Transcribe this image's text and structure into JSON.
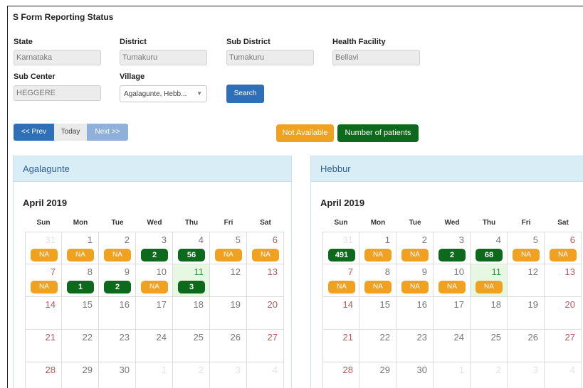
{
  "page": {
    "title": "S Form Reporting Status"
  },
  "filters": {
    "state": {
      "label": "State",
      "value": "Karnataka"
    },
    "district": {
      "label": "District",
      "value": "Tumakuru"
    },
    "sub_district": {
      "label": "Sub District",
      "value": "Tumakuru"
    },
    "health_facility": {
      "label": "Health Facility",
      "value": "Bellavi"
    },
    "sub_center": {
      "label": "Sub Center",
      "value": "HEGGERE"
    },
    "village": {
      "label": "Village",
      "value": "Agalagunte, Hebb..."
    },
    "search_label": "Search"
  },
  "nav": {
    "prev": "<< Prev",
    "today": "Today",
    "next": "Next >>"
  },
  "legend": {
    "not_available": {
      "label": "Not Available",
      "color": "#f0a11f"
    },
    "patients": {
      "label": "Number of patients",
      "color": "#0d6a1d"
    }
  },
  "weekdays": [
    "Sun",
    "Mon",
    "Tue",
    "Wed",
    "Thu",
    "Fri",
    "Sat"
  ],
  "calendars": [
    {
      "village": "Agalagunte",
      "month": "April 2019",
      "weeks": [
        [
          {
            "day": "31",
            "other": true,
            "status": "NA"
          },
          {
            "day": "1",
            "status": "NA"
          },
          {
            "day": "2",
            "status": "NA"
          },
          {
            "day": "3",
            "status": "2"
          },
          {
            "day": "4",
            "status": "56"
          },
          {
            "day": "5",
            "status": "NA"
          },
          {
            "day": "6",
            "status": "NA"
          }
        ],
        [
          {
            "day": "7",
            "status": "NA"
          },
          {
            "day": "8",
            "status": "1"
          },
          {
            "day": "9",
            "status": "2"
          },
          {
            "day": "10",
            "status": "NA"
          },
          {
            "day": "11",
            "today": true,
            "status": "3"
          },
          {
            "day": "12"
          },
          {
            "day": "13"
          }
        ],
        [
          {
            "day": "14"
          },
          {
            "day": "15"
          },
          {
            "day": "16"
          },
          {
            "day": "17"
          },
          {
            "day": "18"
          },
          {
            "day": "19"
          },
          {
            "day": "20"
          }
        ],
        [
          {
            "day": "21"
          },
          {
            "day": "22"
          },
          {
            "day": "23"
          },
          {
            "day": "24"
          },
          {
            "day": "25"
          },
          {
            "day": "26"
          },
          {
            "day": "27"
          }
        ],
        [
          {
            "day": "28"
          },
          {
            "day": "29"
          },
          {
            "day": "30"
          },
          {
            "day": "1",
            "other": true
          },
          {
            "day": "2",
            "other": true
          },
          {
            "day": "3",
            "other": true
          },
          {
            "day": "4",
            "other": true
          }
        ]
      ]
    },
    {
      "village": "Hebbur",
      "month": "April 2019",
      "weeks": [
        [
          {
            "day": "31",
            "other": true,
            "status": "491"
          },
          {
            "day": "1",
            "status": "NA"
          },
          {
            "day": "2",
            "status": "NA"
          },
          {
            "day": "3",
            "status": "2"
          },
          {
            "day": "4",
            "status": "68"
          },
          {
            "day": "5",
            "status": "NA"
          },
          {
            "day": "6",
            "status": "NA"
          }
        ],
        [
          {
            "day": "7",
            "status": "NA"
          },
          {
            "day": "8",
            "status": "NA"
          },
          {
            "day": "9",
            "status": "NA"
          },
          {
            "day": "10",
            "status": "NA"
          },
          {
            "day": "11",
            "today": true,
            "status": "NA"
          },
          {
            "day": "12"
          },
          {
            "day": "13"
          }
        ],
        [
          {
            "day": "14"
          },
          {
            "day": "15"
          },
          {
            "day": "16"
          },
          {
            "day": "17"
          },
          {
            "day": "18"
          },
          {
            "day": "19"
          },
          {
            "day": "20"
          }
        ],
        [
          {
            "day": "21"
          },
          {
            "day": "22"
          },
          {
            "day": "23"
          },
          {
            "day": "24"
          },
          {
            "day": "25"
          },
          {
            "day": "26"
          },
          {
            "day": "27"
          }
        ],
        [
          {
            "day": "28"
          },
          {
            "day": "29"
          },
          {
            "day": "30"
          },
          {
            "day": "1",
            "other": true
          },
          {
            "day": "2",
            "other": true
          },
          {
            "day": "3",
            "other": true
          },
          {
            "day": "4",
            "other": true
          }
        ]
      ]
    }
  ]
}
